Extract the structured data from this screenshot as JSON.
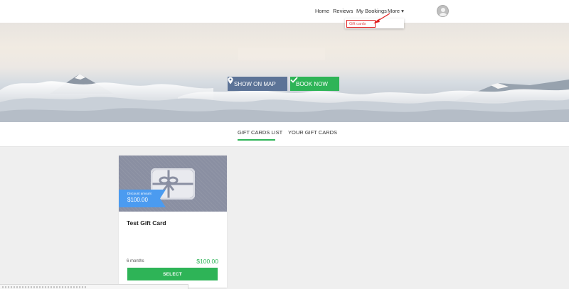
{
  "nav": {
    "items": [
      "Home",
      "Reviews",
      "My Bookings",
      "More ▾"
    ]
  },
  "dropdown": {
    "item": "Gift cards"
  },
  "hero": {
    "show_on_map": "SHOW ON MAP",
    "book_now": "BOOK NOW"
  },
  "tabs": {
    "list": "GIFT CARDS LIST",
    "yours": "YOUR GIFT CARDS"
  },
  "card": {
    "ribbon_label": "Discount amount",
    "ribbon_amount": "$100.00",
    "title": "Test Gift Card",
    "duration": "6 months",
    "price": "$100.00",
    "select": "SELECT"
  },
  "icons": {
    "map": "map-pin-icon",
    "book": "check-icon",
    "card": "gift-card-icon"
  },
  "colors": {
    "accent_green": "#2eb457",
    "map_button": "#5c7397",
    "ribbon": "#4b9bf0",
    "highlight": "#e02020"
  }
}
